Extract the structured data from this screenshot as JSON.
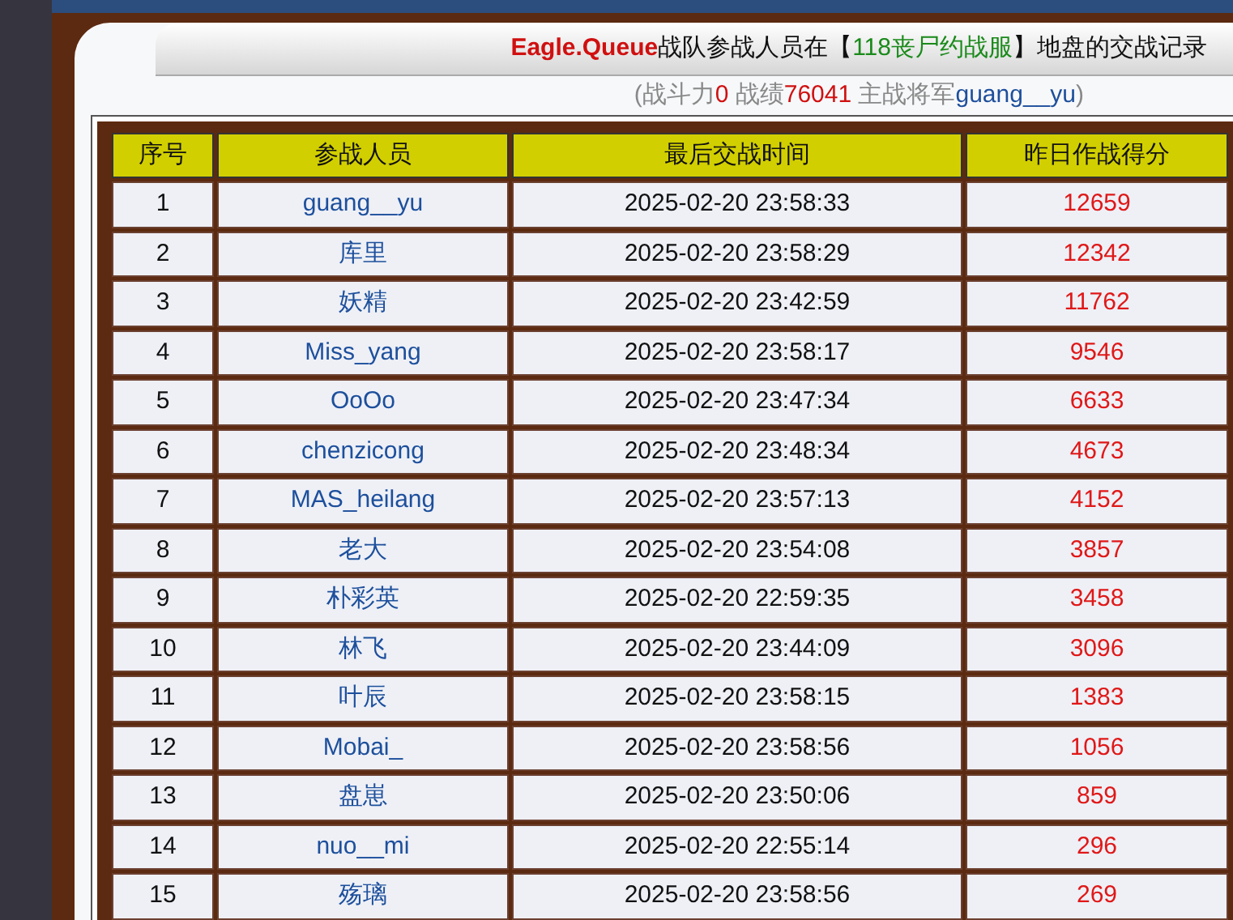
{
  "title": {
    "team": "Eagle.Queue",
    "text1": "战队参战人员在【",
    "server": "118丧尸约战服",
    "text2": "】地盘的交战记录"
  },
  "subtitle": {
    "open": "(",
    "power_label": "战斗力",
    "power": "0",
    "record_label": " 战绩",
    "record": "76041",
    "general_label": " 主战将军",
    "general": "guang__yu",
    "close": ")"
  },
  "table": {
    "columns": [
      "序号",
      "参战人员",
      "最后交战时间",
      "昨日作战得分"
    ],
    "rows": [
      [
        "1",
        "guang__yu",
        "2025-02-20 23:58:33",
        "12659"
      ],
      [
        "2",
        "库里",
        "2025-02-20 23:58:29",
        "12342"
      ],
      [
        "3",
        "妖精",
        "2025-02-20 23:42:59",
        "11762"
      ],
      [
        "4",
        "Miss_yang",
        "2025-02-20 23:58:17",
        "9546"
      ],
      [
        "5",
        "OoOo",
        "2025-02-20 23:47:34",
        "6633"
      ],
      [
        "6",
        "chenzicong",
        "2025-02-20 23:48:34",
        "4673"
      ],
      [
        "7",
        "MAS_heilang",
        "2025-02-20 23:57:13",
        "4152"
      ],
      [
        "8",
        "老大",
        "2025-02-20 23:54:08",
        "3857"
      ],
      [
        "9",
        "朴彩英",
        "2025-02-20 22:59:35",
        "3458"
      ],
      [
        "10",
        "林飞",
        "2025-02-20 23:44:09",
        "3096"
      ],
      [
        "11",
        "叶辰",
        "2025-02-20 23:58:15",
        "1383"
      ],
      [
        "12",
        "Mobai_",
        "2025-02-20 23:58:56",
        "1056"
      ],
      [
        "13",
        "盘崽",
        "2025-02-20 23:50:06",
        "859"
      ],
      [
        "14",
        "nuo__mi",
        "2025-02-20 22:55:14",
        "296"
      ],
      [
        "15",
        "殇璃",
        "2025-02-20 23:58:56",
        "269"
      ]
    ]
  }
}
